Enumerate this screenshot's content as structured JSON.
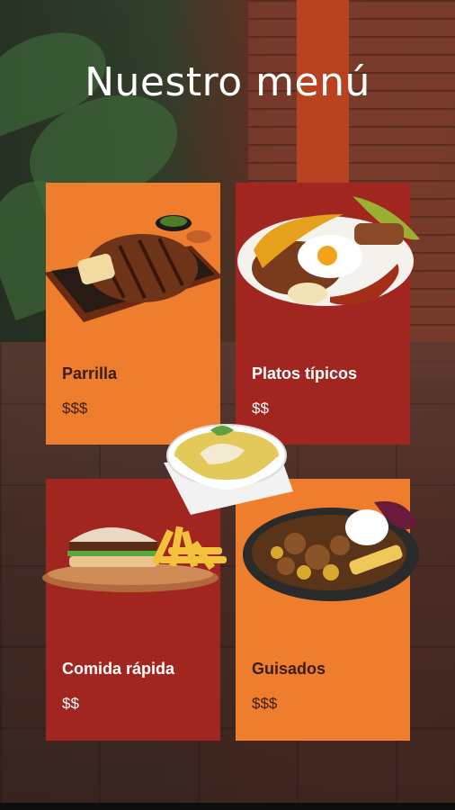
{
  "header": {
    "title": "Nuestro menú"
  },
  "menu": {
    "items": [
      {
        "name": "Parrilla",
        "price": "$$$",
        "icon": "grilled-steak-icon",
        "color": "#ee7e2d"
      },
      {
        "name": "Platos típicos",
        "price": "$$",
        "icon": "bandeja-paisa-icon",
        "color": "#a1261f"
      },
      {
        "name": "Comida rápida",
        "price": "$$",
        "icon": "burger-fries-icon",
        "color": "#a1261f"
      },
      {
        "name": "Guisados",
        "price": "$$$",
        "icon": "stew-plate-icon",
        "color": "#ee7e2d"
      }
    ],
    "center_decoration": {
      "icon": "soup-bowl-icon"
    }
  },
  "colors": {
    "orange": "#ee7e2d",
    "red": "#a1261f",
    "title": "#ffffff"
  }
}
